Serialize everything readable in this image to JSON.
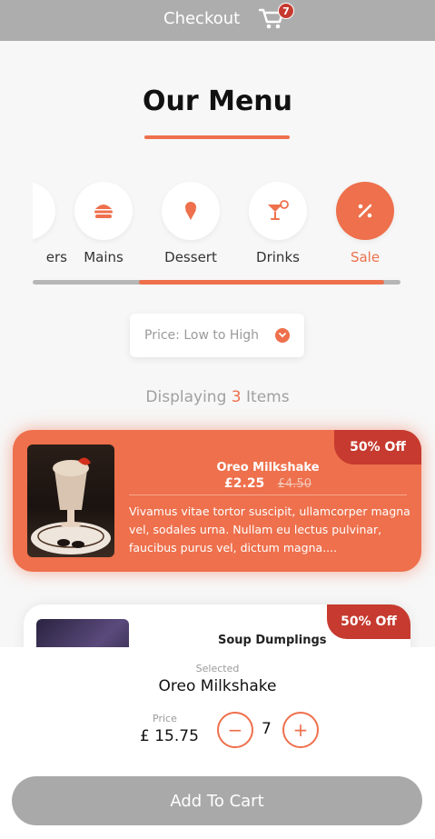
{
  "header": {
    "title": "Checkout",
    "cart_count": "7"
  },
  "page_title": "Our Menu",
  "categories": [
    {
      "label": "ers",
      "icon": "burger-partial-icon"
    },
    {
      "label": "Mains",
      "icon": "burger-icon"
    },
    {
      "label": "Dessert",
      "icon": "ice-cream-icon"
    },
    {
      "label": "Drinks",
      "icon": "cocktail-icon"
    },
    {
      "label": "Sale",
      "icon": "percent-icon",
      "active": true
    }
  ],
  "sort": {
    "value": "Price: Low to High"
  },
  "display": {
    "prefix": "Displaying",
    "count": "3",
    "suffix": "Items"
  },
  "items": [
    {
      "name": "Oreo Milkshake",
      "price": "£2.25",
      "old_price": "£4.50",
      "discount": "50% Off",
      "description": "Vivamus vitae tortor suscipit, ullamcorper magna vel, sodales urna. Nullam eu lectus pulvinar, faucibus purus vel, dictum magna...."
    },
    {
      "name": "Soup Dumplings",
      "discount": "50% Off"
    }
  ],
  "selection": {
    "label": "Selected",
    "name": "Oreo Milkshake",
    "price_label": "Price",
    "price": "£ 15.75",
    "quantity": "7",
    "minus": "−",
    "plus": "+"
  },
  "add_to_cart": "Add To Cart",
  "colors": {
    "accent": "#ee704c",
    "badge": "#c63a2f",
    "topbar": "#adadad",
    "button_disabled": "#a9a9a9"
  }
}
